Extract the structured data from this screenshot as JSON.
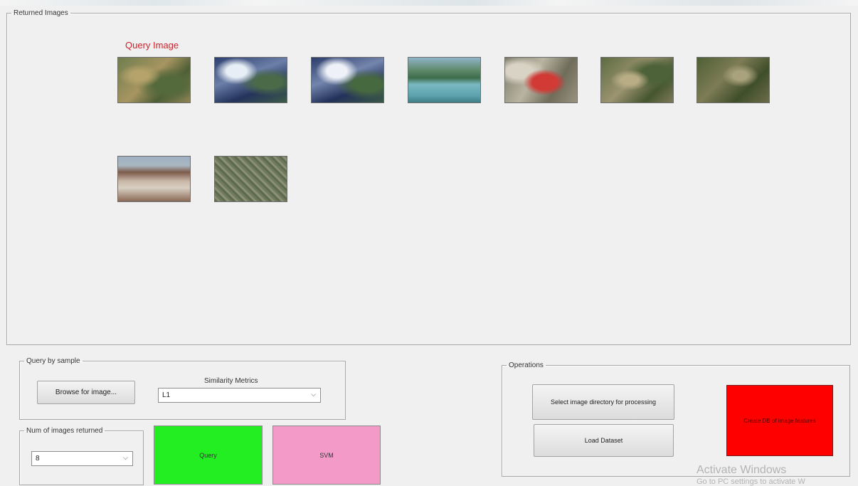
{
  "returned_panel": {
    "legend": "Returned Images",
    "query_label": "Query Image",
    "thumbnails": [
      "aerial-residential-1",
      "aerial-coast-1",
      "aerial-coast-2",
      "lake-shore",
      "aerial-red-roof",
      "aerial-residential-2",
      "aerial-farmland",
      "beach-birds",
      "aerial-dense-grid"
    ]
  },
  "query_by_sample": {
    "legend": "Query by sample",
    "browse_label": "Browse for image...",
    "similarity_label": "Similarity Metrics",
    "similarity_value": "L1"
  },
  "num_images": {
    "legend": "Num of images returned",
    "value": "8"
  },
  "actions": {
    "query_label": "Query",
    "svm_label": "SVM"
  },
  "operations": {
    "legend": "Operations",
    "select_dir_label": "Select image directory for processing",
    "load_dataset_label": "Load Dataset",
    "create_db_label": "Create DB of image features"
  },
  "watermark": {
    "line1": "Activate Windows",
    "line2": "Go to PC settings to activate W"
  },
  "colors": {
    "query_label": "#d0202a",
    "query_button": "#22ee22",
    "svm_button": "#f49ac9",
    "create_db_button": "#ff0000"
  }
}
